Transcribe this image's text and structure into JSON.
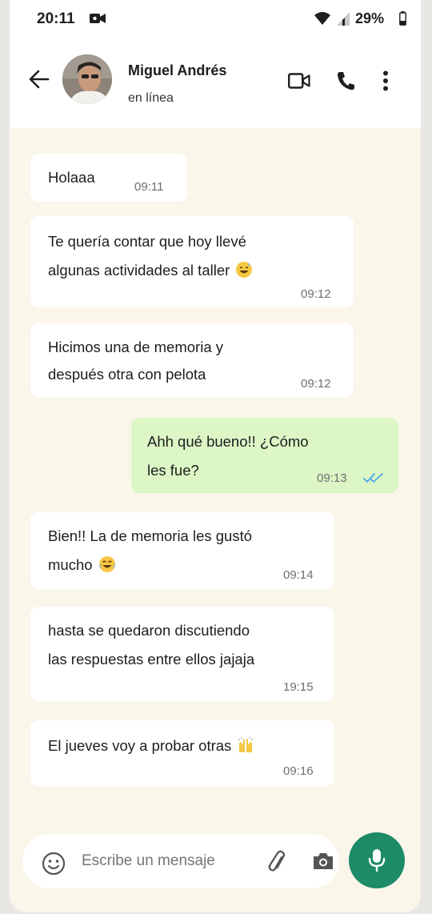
{
  "status_bar": {
    "time": "20:11",
    "battery": "29%"
  },
  "header": {
    "contact_name": "Miguel Andrés",
    "presence": "en línea"
  },
  "messages": [
    {
      "text": "Holaaa",
      "time": "09:11",
      "direction": "incoming"
    },
    {
      "line1": "Te quería contar que hoy llevé",
      "line2": "algunas actividades al taller",
      "emoji": "grinning-sweat-emoji",
      "time": "09:12",
      "direction": "incoming"
    },
    {
      "line1": "Hicimos una de memoria y",
      "line2": "después otra con pelota",
      "time": "09:12",
      "direction": "incoming"
    },
    {
      "line1": "Ahh qué bueno!! ¿Cómo",
      "line2": "les fue?",
      "time": "09:13",
      "direction": "outgoing",
      "status": "read"
    },
    {
      "line1": "Bien!! La de memoria les gustó",
      "line2": "mucho",
      "emoji": "tears-of-joy-emoji",
      "time": "09:14",
      "direction": "incoming"
    },
    {
      "line1": "hasta se quedaron discutiendo",
      "line2": "las respuestas entre ellos jajaja",
      "time": "19:15",
      "direction": "incoming"
    },
    {
      "text": "El jueves voy a probar otras",
      "emoji": "raising-hands-emoji",
      "time": "09:16",
      "direction": "incoming"
    }
  ],
  "composer": {
    "placeholder": "Escribe un mensaje"
  },
  "colors": {
    "chat_background": "#fbf6ea",
    "outgoing_bubble": "#dcf6c6",
    "incoming_bubble": "#ffffff",
    "accent": "#1d8a68",
    "read_ticks": "#4fa6e8"
  }
}
